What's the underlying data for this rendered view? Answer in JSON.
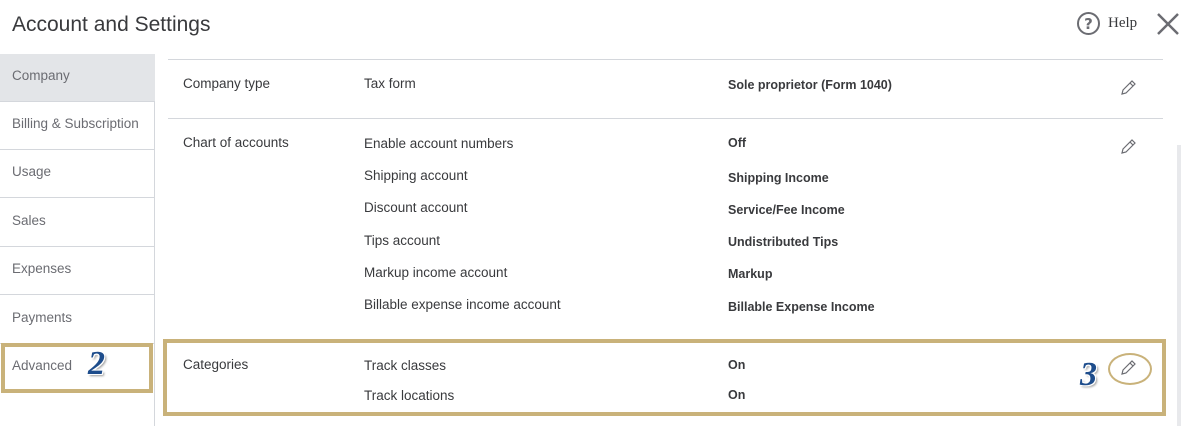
{
  "header": {
    "title": "Account and Settings",
    "help_label": "Help",
    "help_symbol": "?"
  },
  "sidebar": {
    "items": [
      {
        "label": "Company"
      },
      {
        "label": "Billing & Subscription"
      },
      {
        "label": "Usage"
      },
      {
        "label": "Sales"
      },
      {
        "label": "Expenses"
      },
      {
        "label": "Payments"
      },
      {
        "label": "Advanced"
      }
    ],
    "active": "Company"
  },
  "sections": {
    "company_type": {
      "title": "Company type",
      "rows": [
        {
          "label": "Tax form",
          "value": "Sole proprietor (Form 1040)"
        }
      ]
    },
    "chart_of_accounts": {
      "title": "Chart of accounts",
      "rows": [
        {
          "label": "Enable account numbers",
          "value": "Off"
        },
        {
          "label": "Shipping account",
          "value": "Shipping Income"
        },
        {
          "label": "Discount account",
          "value": "Service/Fee Income"
        },
        {
          "label": "Tips account",
          "value": "Undistributed Tips"
        },
        {
          "label": "Markup income account",
          "value": "Markup"
        },
        {
          "label": "Billable expense income account",
          "value": "Billable Expense Income"
        }
      ]
    },
    "categories": {
      "title": "Categories",
      "rows": [
        {
          "label": "Track classes",
          "value": "On"
        },
        {
          "label": "Track locations",
          "value": "On"
        }
      ]
    }
  },
  "annotations": {
    "step_advanced": "2",
    "step_edit": "3"
  },
  "colors": {
    "highlight": "#c9b27a",
    "marker": "#1e4d8c",
    "text": "#393a3d",
    "muted": "#6b6c72",
    "active_bg": "#e3e5e8"
  },
  "icons": [
    "help-circle-icon",
    "close-icon",
    "pencil-icon"
  ]
}
